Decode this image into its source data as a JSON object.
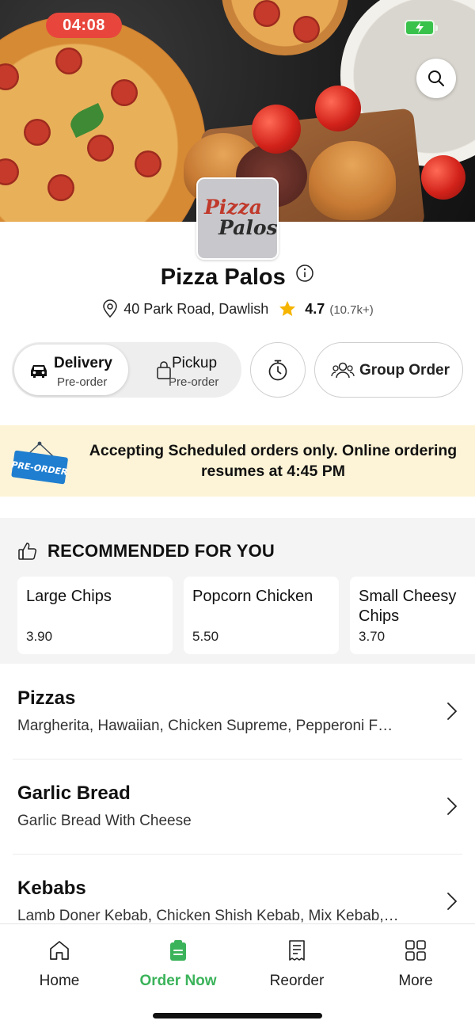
{
  "status_bar": {
    "time": "04:08",
    "battery_icon": "battery-charging-icon"
  },
  "hero": {
    "search_icon": "search-icon",
    "logo_text": [
      "Pizza",
      "Palos"
    ]
  },
  "restaurant": {
    "name": "Pizza Palos",
    "address": "40 Park Road, Dawlish",
    "rating": "4.7",
    "reviews": "(10.7k+)"
  },
  "order_modes": {
    "delivery": {
      "label": "Delivery",
      "sub": "Pre-order",
      "selected": true
    },
    "pickup": {
      "label": "Pickup",
      "sub": "Pre-order",
      "selected": false
    },
    "schedule_icon": "timer-icon",
    "group_order": "Group Order"
  },
  "banner": {
    "sign_text": "PRE-ORDER",
    "message": "Accepting Scheduled orders only. Online ordering resumes at 4:45 PM"
  },
  "recommended": {
    "title": "RECOMMENDED FOR YOU",
    "items": [
      {
        "name": "Large Chips",
        "price": "3.90"
      },
      {
        "name": "Popcorn Chicken",
        "price": "5.50"
      },
      {
        "name": "Small Cheesy Chips",
        "price": "3.70"
      }
    ]
  },
  "categories": [
    {
      "name": "Pizzas",
      "items": "Margherita, Hawaiian, Chicken Supreme, Pepperoni F…"
    },
    {
      "name": "Garlic Bread",
      "items": "Garlic Bread With Cheese"
    },
    {
      "name": "Kebabs",
      "items": "Lamb Doner Kebab, Chicken Shish Kebab, Mix Kebab,…"
    }
  ],
  "tabs": [
    {
      "label": "Home",
      "icon": "home-icon",
      "active": false
    },
    {
      "label": "Order Now",
      "icon": "order-icon",
      "active": true
    },
    {
      "label": "Reorder",
      "icon": "receipt-icon",
      "active": false
    },
    {
      "label": "More",
      "icon": "grid-icon",
      "active": false
    }
  ],
  "colors": {
    "accent": "#3bb35a",
    "banner_bg": "#fdf3d6",
    "star": "#f5b400",
    "time_pill": "#e8463c"
  }
}
